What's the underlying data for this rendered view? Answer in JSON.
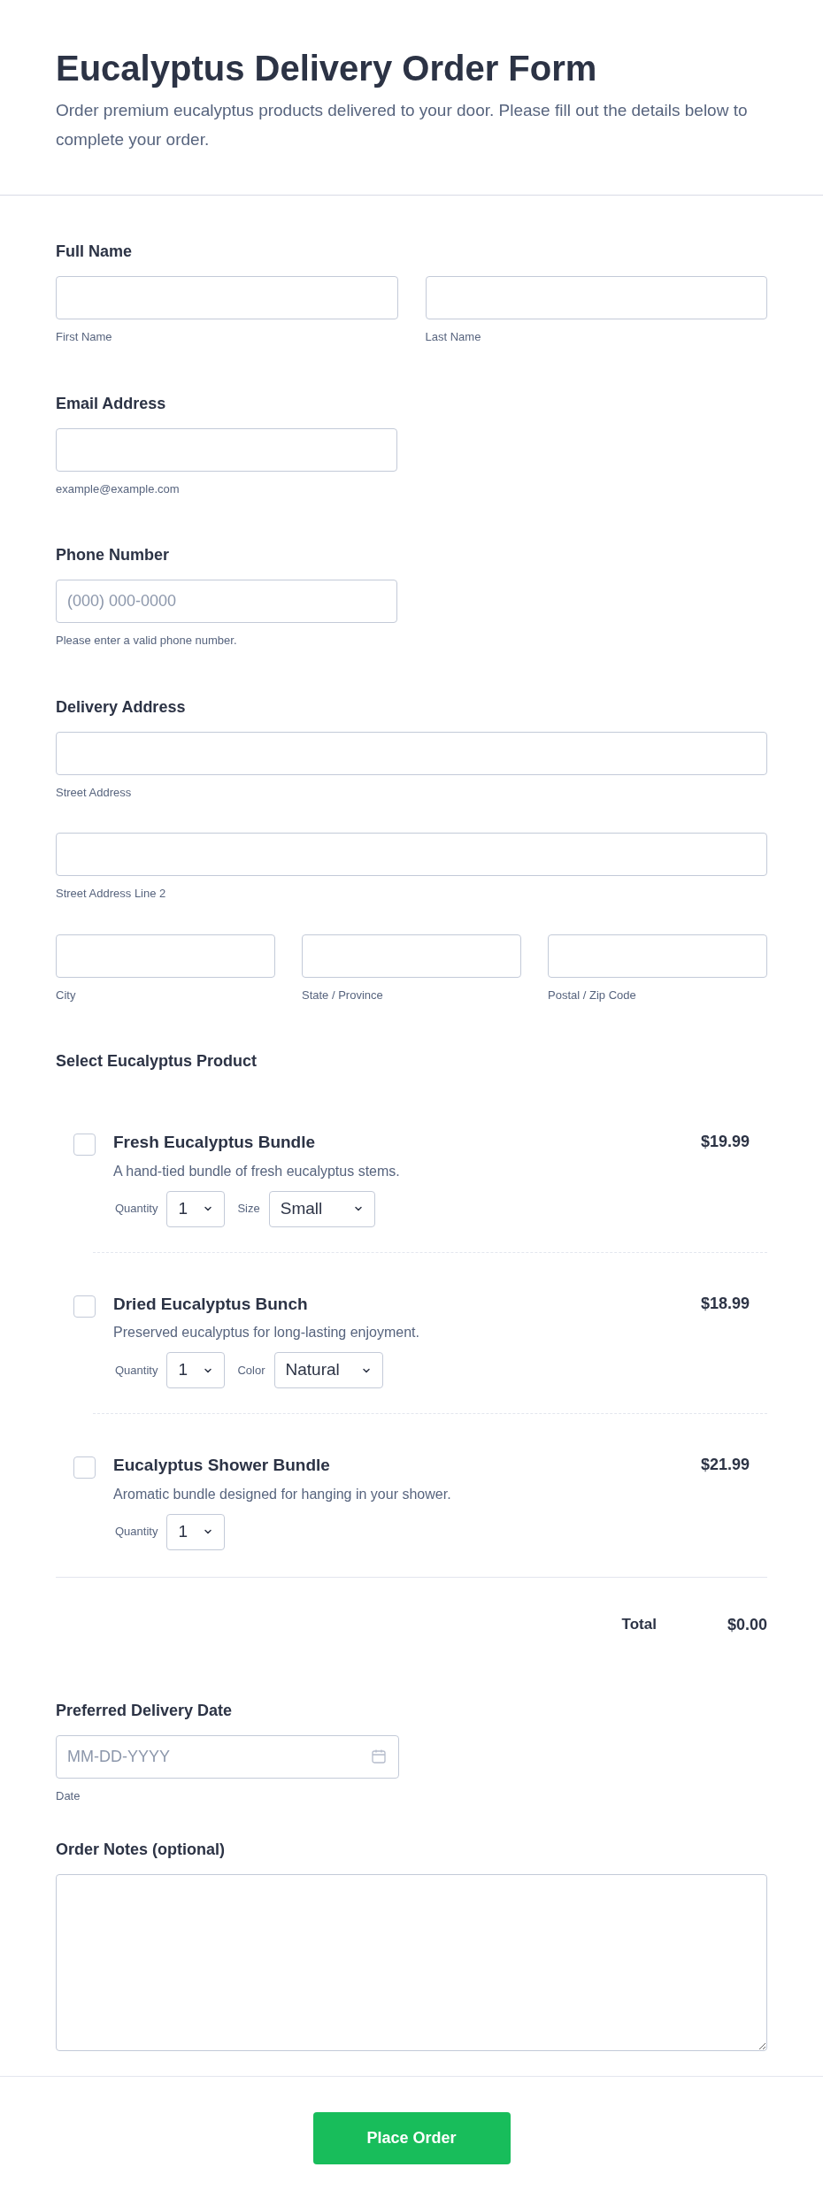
{
  "header": {
    "title": "Eucalyptus Delivery Order Form",
    "description": "Order premium eucalyptus products delivered to your door. Please fill out the details below to complete your order."
  },
  "sections": [
    {
      "kind": "full",
      "label": "Full Name",
      "rows": [
        [
          {
            "sublabel": "First Name"
          },
          {
            "sublabel": "Last Name"
          }
        ]
      ]
    },
    {
      "kind": "half",
      "label": "Email Address",
      "rows": [
        [
          {
            "sublabel": "example@example.com"
          }
        ]
      ]
    },
    {
      "kind": "half",
      "label": "Phone Number",
      "rows": [
        [
          {
            "placeholder": "(000) 000-0000",
            "sublabel": "Please enter a valid phone number."
          }
        ]
      ]
    },
    {
      "kind": "full",
      "label": "Delivery Address",
      "rows": [
        [
          {
            "sublabel": "Street Address"
          }
        ],
        [
          {
            "sublabel": "Street Address Line 2"
          }
        ],
        [
          {
            "sublabel": "City"
          },
          {
            "sublabel": "State / Province"
          },
          {
            "sublabel": "Postal / Zip Code"
          }
        ]
      ]
    }
  ],
  "products": {
    "label": "Select Eucalyptus Product",
    "items": [
      {
        "name": "Fresh Eucalyptus Bundle",
        "description": "A hand-tied bundle of fresh eucalyptus stems.",
        "price": "$19.99",
        "checked": false,
        "options": [
          {
            "label": "Quantity",
            "value": "1"
          },
          {
            "label": "Size",
            "value": "Small"
          }
        ]
      },
      {
        "name": "Dried Eucalyptus Bunch",
        "description": "Preserved eucalyptus for long-lasting enjoyment.",
        "price": "$18.99",
        "checked": false,
        "options": [
          {
            "label": "Quantity",
            "value": "1"
          },
          {
            "label": "Color",
            "value": "Natural"
          }
        ]
      },
      {
        "name": "Eucalyptus Shower Bundle",
        "description": "Aromatic bundle designed for hanging in your shower.",
        "price": "$21.99",
        "checked": false,
        "options": [
          {
            "label": "Quantity",
            "value": "1"
          }
        ]
      }
    ],
    "total_label": "Total",
    "total_value": "$0.00"
  },
  "date": {
    "label": "Preferred Delivery Date",
    "placeholder": "MM-DD-YYYY",
    "sublabel": "Date"
  },
  "notes": {
    "label": "Order Notes (optional)"
  },
  "submit": "Place Order"
}
